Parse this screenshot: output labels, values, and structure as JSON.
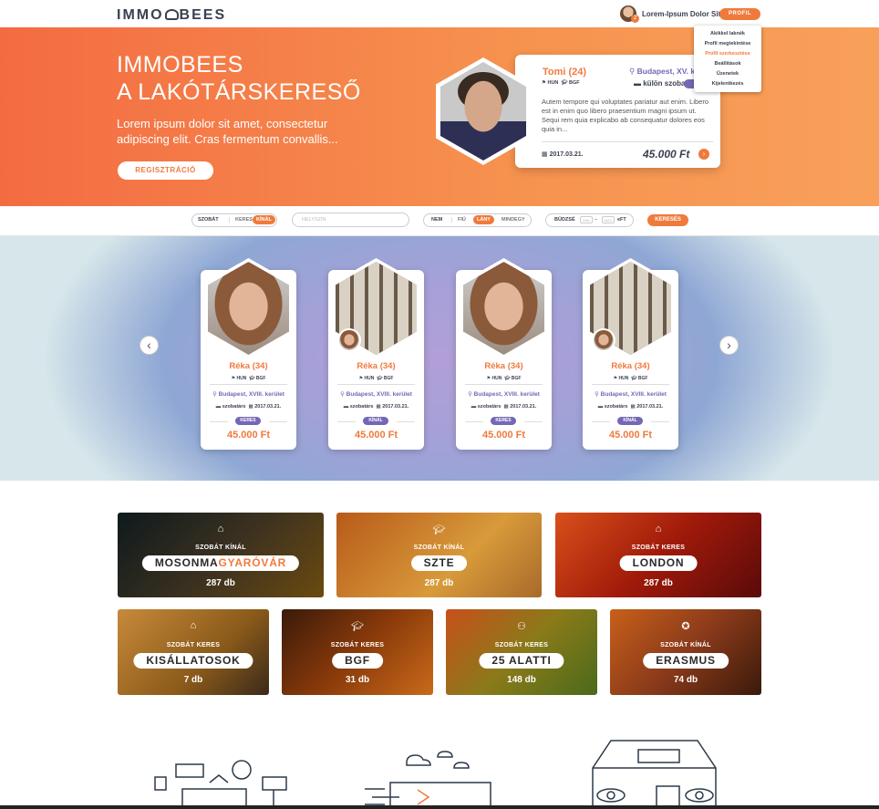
{
  "header": {
    "logo_left": "IMMO",
    "logo_right": "BEES",
    "user_name": "Lorem-Ipsum Dolor Sit",
    "notification_count": "2",
    "profile_button": "PROFIL",
    "menu": [
      "Akikkel laknék",
      "Profil megtekintése",
      "Profil szerkesztése",
      "Beállítások",
      "Üzenetek",
      "Kijelentkezés"
    ],
    "menu_active_index": 2
  },
  "hero": {
    "title_line1": "IMMOBEES",
    "title_line2": "A LAKÓTÁRSKERESŐ",
    "text": "Lorem ipsum dolor sit amet, consectetur adipiscing elit. Cras fermentum convallis...",
    "register_button": "REGISZTRÁCIÓ",
    "profile_card": {
      "name": "Tomi (24)",
      "location": "Budapest, XV. ker",
      "nationality": "HUN",
      "school": "BGF",
      "room_type": "külön szoba",
      "description": "Autem tempore qui voluptates pariatur aut enim. Libero est in enim quo libero praesentium magni ipsum ut. Sequi rem quia explicabo ab consequatur dolores eos quia in...",
      "date": "2017.03.21.",
      "price": "45.000 Ft"
    }
  },
  "search": {
    "mode_label": "SZOBÁT",
    "mode_options": [
      "KERES",
      "KÍNÁL"
    ],
    "mode_selected": "KÍNÁL",
    "location_placeholder": "HELYSZÍN",
    "gender_label": "NEM",
    "gender_options": [
      "FIÚ",
      "LÁNY",
      "MINDEGY"
    ],
    "gender_selected": "LÁNY",
    "budget_label": "BÜDZSÉ",
    "budget_min_placeholder": "MIN",
    "budget_dash": "–",
    "budget_max_placeholder": "MAX",
    "budget_unit": "eFT",
    "search_button": "KERESÉS"
  },
  "listings": [
    {
      "name": "Réka (34)",
      "nationality": "HUN",
      "school": "BGF",
      "location": "Budapest, XVIII. kerület",
      "type": "szobatárs",
      "date": "2017.03.21.",
      "tag": "KERES",
      "price": "45.000 Ft",
      "photo": "person"
    },
    {
      "name": "Réka (34)",
      "nationality": "HUN",
      "school": "BGF",
      "location": "Budapest, XVIII. kerület",
      "type": "szobatárs",
      "date": "2017.03.21.",
      "tag": "KÍNÁL",
      "price": "45.000 Ft",
      "photo": "room"
    },
    {
      "name": "Réka (34)",
      "nationality": "HUN",
      "school": "BGF",
      "location": "Budapest, XVIII. kerület",
      "type": "szobatárs",
      "date": "2017.03.21.",
      "tag": "KERES",
      "price": "45.000 Ft",
      "photo": "person"
    },
    {
      "name": "Réka (34)",
      "nationality": "HUN",
      "school": "BGF",
      "location": "Budapest, XVIII. kerület",
      "type": "szobatárs",
      "date": "2017.03.21.",
      "tag": "KÍNÁL",
      "price": "45.000 Ft",
      "photo": "room"
    }
  ],
  "categories": [
    {
      "label": "SZOBÁT KÍNÁL",
      "name_a": "MOSONMA",
      "name_b": "GYARÓVÁR",
      "count": "287 db",
      "icon": "building-icon"
    },
    {
      "label": "SZOBÁT KÍNÁL",
      "name_a": "SZTE",
      "name_b": "",
      "count": "287 db",
      "icon": "graduation-cap-icon"
    },
    {
      "label": "SZOBÁT KERES",
      "name_a": "LONDON",
      "name_b": "",
      "count": "287 db",
      "icon": "building-icon"
    },
    {
      "label": "SZOBÁT KERES",
      "name_a": "KISÁLLATOSOK",
      "name_b": "",
      "count": "7 db",
      "icon": "building-icon"
    },
    {
      "label": "SZOBÁT KERES",
      "name_a": "BGF",
      "name_b": "",
      "count": "31 db",
      "icon": "graduation-cap-icon"
    },
    {
      "label": "SZOBÁT KERES",
      "name_a": "25 ALATTI",
      "name_b": "",
      "count": "148 db",
      "icon": "people-icon"
    },
    {
      "label": "SZOBÁT KÍNÁL",
      "name_a": "ERASMUS",
      "name_b": "",
      "count": "74 db",
      "icon": "eu-stars-icon"
    }
  ],
  "colors": {
    "accent": "#f07a3c",
    "purple": "#7567b5",
    "dark": "#3b4150"
  }
}
